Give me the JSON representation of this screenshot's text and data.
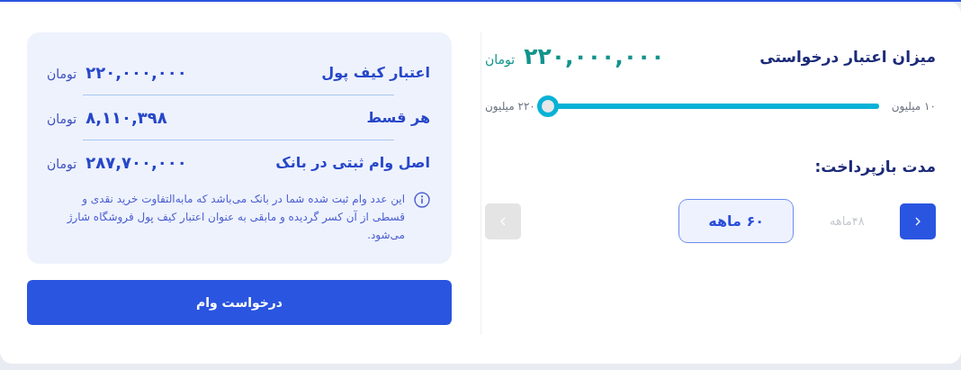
{
  "request": {
    "title": "میزان اعتبار درخواستی",
    "amount": "۲۲۰,۰۰۰,۰۰۰",
    "currency": "تومان"
  },
  "slider": {
    "min_label": "۱۰ میلیون",
    "max_label": "۲۲۰ میلیون",
    "level": 1
  },
  "term": {
    "title": "مدت بازپرداخت:",
    "next_disabled": false,
    "prev_disabled": true,
    "options": [
      {
        "label": "۴۸ماهه",
        "selected": false
      },
      {
        "label": "۶۰ ماهه",
        "selected": true
      }
    ]
  },
  "summary": {
    "rows": [
      {
        "label": "اعتبار کیف پول",
        "value": "۲۲۰,۰۰۰,۰۰۰",
        "currency": "تومان"
      },
      {
        "label": "هر قسط",
        "value": "۸,۱۱۰,۳۹۸",
        "currency": "تومان"
      },
      {
        "label": "اصل وام ثبتی در بانک",
        "value": "۲۸۷,۷۰۰,۰۰۰",
        "currency": "تومان"
      }
    ],
    "note": "این عدد وام ثبت شده شما در بانک می‌باشد که مابه‌التفاوت خرید نقدی و قسطی از آن کسر گردیده و مابقی به عنوان اعتبار کیف پول فروشگاه شارژ می‌شود."
  },
  "submit": "درخواست وام"
}
